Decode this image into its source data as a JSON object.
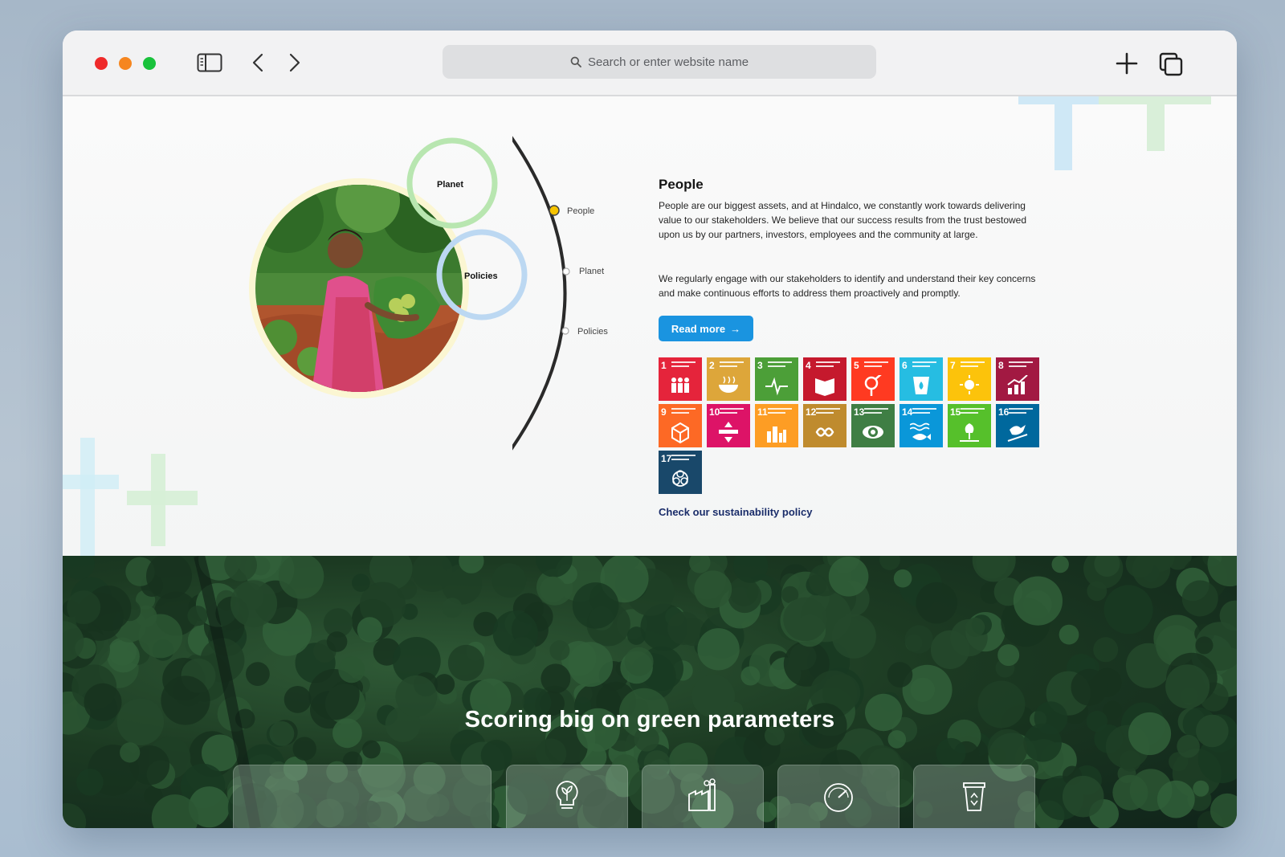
{
  "browser": {
    "address_placeholder": "Search or enter website name",
    "icons": [
      "sidebar-icon",
      "back-icon",
      "forward-icon",
      "search-icon",
      "new-tab-icon",
      "tabs-overview-icon"
    ]
  },
  "timeline": {
    "items": [
      "People",
      "Planet",
      "Policies"
    ],
    "active": "People"
  },
  "rings": {
    "planet": "Planet",
    "policies": "Policies"
  },
  "content": {
    "heading": "People",
    "paragraph1": "People are our biggest assets, and at Hindalco, we constantly work towards delivering value to our stakeholders. We believe that our success results from the trust bestowed upon us by our partners, investors, employees and the community at large.",
    "paragraph2": "We regularly engage with our stakeholders to identify and understand their key concerns and make continuous efforts to address them proactively and promptly.",
    "read_more": "Read more",
    "policy_link": "Check our sustainability policy"
  },
  "sdgs": [
    {
      "num": "1",
      "color": "#e5243b"
    },
    {
      "num": "2",
      "color": "#dda63a"
    },
    {
      "num": "3",
      "color": "#4c9f38"
    },
    {
      "num": "4",
      "color": "#c5192d"
    },
    {
      "num": "5",
      "color": "#ff3a21"
    },
    {
      "num": "6",
      "color": "#26bde2"
    },
    {
      "num": "7",
      "color": "#fcc30b"
    },
    {
      "num": "8",
      "color": "#a21942"
    },
    {
      "num": "9",
      "color": "#fd6925"
    },
    {
      "num": "10",
      "color": "#dd1367"
    },
    {
      "num": "11",
      "color": "#fd9d24"
    },
    {
      "num": "12",
      "color": "#bf8b2e"
    },
    {
      "num": "13",
      "color": "#3f7e44"
    },
    {
      "num": "14",
      "color": "#0a97d9"
    },
    {
      "num": "15",
      "color": "#56c02b"
    },
    {
      "num": "16",
      "color": "#00689d"
    },
    {
      "num": "17",
      "color": "#19486a"
    }
  ],
  "green_section": {
    "title": "Scoring big on green parameters",
    "card_icons": [
      "bulb-leaf-icon",
      "factory-icon",
      "gauge-icon",
      "recycle-bin-icon"
    ]
  }
}
